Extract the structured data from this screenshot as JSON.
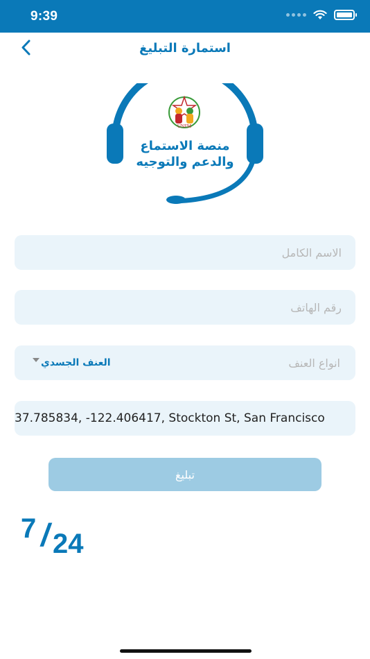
{
  "status_bar": {
    "time": "9:39"
  },
  "header": {
    "title": "استمارة التبليغ"
  },
  "logo": {
    "line1": "منصة الاستماع",
    "line2": "والدعم والتوجيه",
    "org": "UNFM"
  },
  "form": {
    "full_name_placeholder": "الاسم الكامل",
    "phone_placeholder": "رقم الهاتف",
    "violence_type_label": "انواع العنف",
    "violence_type_value": "العنف الجسدي",
    "location_value": "37.785834, -122.406417, Stockton St, San Francisco"
  },
  "submit": {
    "label": "تبليغ"
  },
  "brand": {
    "seven": "7",
    "slash": "/",
    "twentyfour": "24"
  },
  "colors": {
    "primary": "#0a79b8",
    "field_bg": "#eaf4fa",
    "button_disabled": "#9dcbe3"
  }
}
